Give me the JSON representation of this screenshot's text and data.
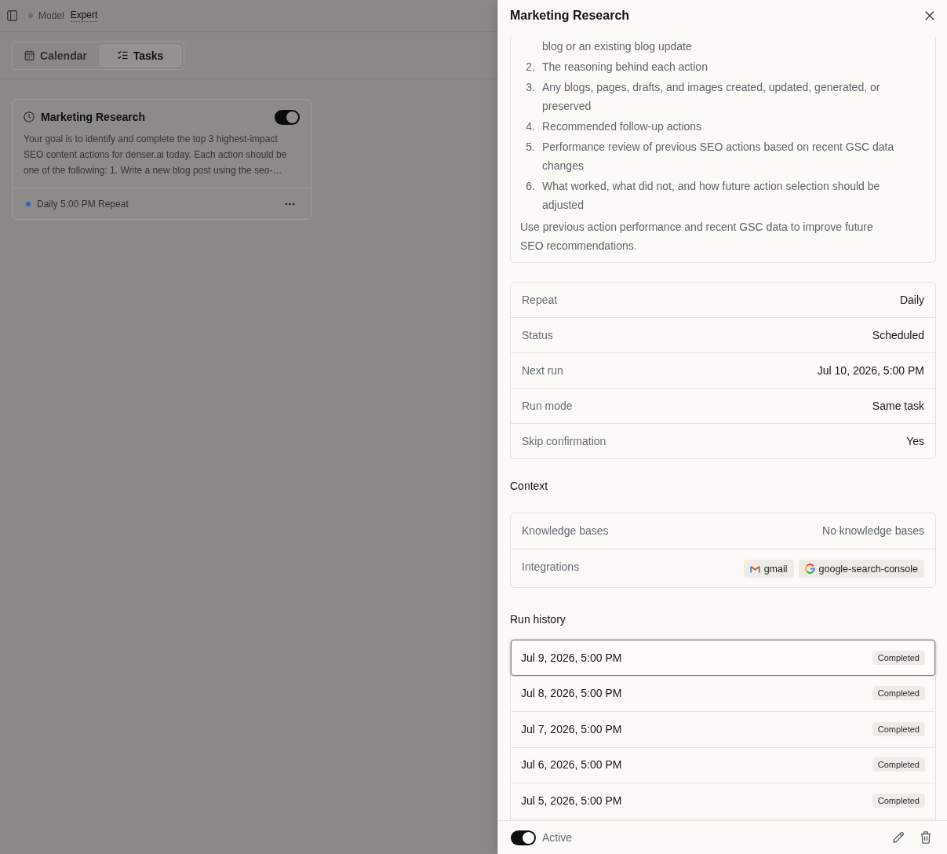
{
  "top_bar": {
    "model_label": "Model",
    "model_value": "Expert"
  },
  "view_tabs": [
    {
      "label": "Calendar",
      "selected": false
    },
    {
      "label": "Tasks",
      "selected": true
    }
  ],
  "task_cards": [
    {
      "title": "Marketing Research",
      "on": true,
      "description": "Your goal is to identify and complete the top 3 highest-impact SEO content actions for denser.ai today. Each action should be one of the following: 1. Write a new blog post using the seo-…",
      "schedule": "Daily 5:00 PM Repeat"
    }
  ],
  "drawer": {
    "title": "Marketing Research",
    "prompt": {
      "items": [
        {
          "text": "blog or an existing blog update"
        },
        {
          "number": "2.",
          "text": "The reasoning behind each action"
        },
        {
          "number": "3.",
          "text": "Any blogs, pages, drafts, and images created, updated, generated, or preserved"
        },
        {
          "number": "4.",
          "text": "Recommended follow-up actions"
        },
        {
          "number": "5.",
          "text": "Performance review of previous SEO actions based on recent GSC data changes"
        },
        {
          "number": "6.",
          "text": "What worked, what did not, and how future action selection should be adjusted"
        }
      ],
      "note": "Use previous action performance and recent GSC data to improve future SEO recommendations."
    },
    "details": [
      {
        "label": "Repeat",
        "value": "Daily"
      },
      {
        "label": "Status",
        "value": "Scheduled"
      },
      {
        "label": "Next run",
        "value": "Jul 10, 2026, 5:00 PM"
      },
      {
        "label": "Run mode",
        "value": "Same task"
      },
      {
        "label": "Skip confirmation",
        "value": "Yes"
      }
    ],
    "context": {
      "heading": "Context",
      "rows": [
        {
          "kind": "text",
          "label": "Knowledge bases",
          "value": "No knowledge bases"
        },
        {
          "kind": "chips",
          "label": "Integrations",
          "chips": [
            "gmail",
            "google-search-console"
          ]
        }
      ]
    },
    "run_history": {
      "heading": "Run history",
      "runs": [
        {
          "date": "Jul 9, 2026, 5:00 PM",
          "status": "Completed",
          "selected": true
        },
        {
          "date": "Jul 8, 2026, 5:00 PM",
          "status": "Completed",
          "selected": false
        },
        {
          "date": "Jul 7, 2026, 5:00 PM",
          "status": "Completed",
          "selected": false
        },
        {
          "date": "Jul 6, 2026, 5:00 PM",
          "status": "Completed",
          "selected": false
        },
        {
          "date": "Jul 5, 2026, 5:00 PM",
          "status": "Completed",
          "selected": false
        }
      ]
    },
    "footer": {
      "on": true,
      "label": "Active"
    }
  }
}
